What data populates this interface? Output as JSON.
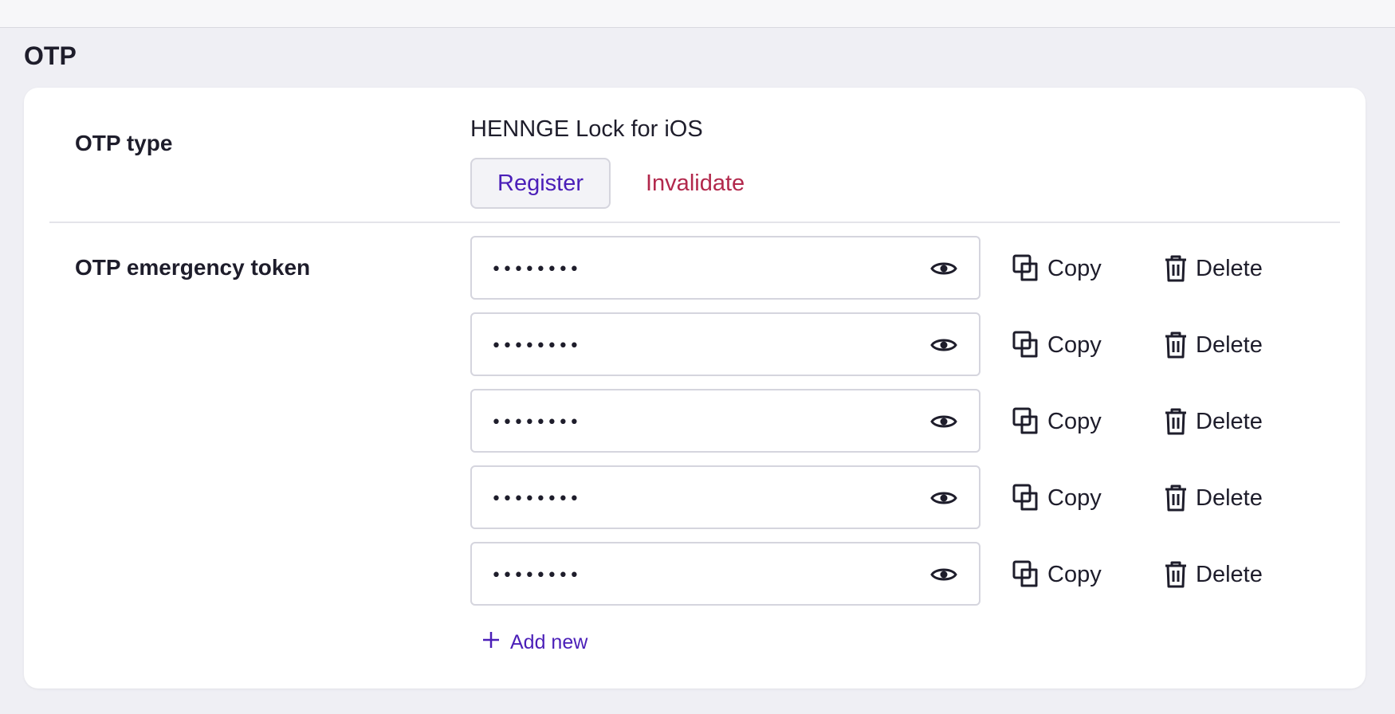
{
  "section": {
    "title": "OTP"
  },
  "otp_type": {
    "label": "OTP type",
    "value": "HENNGE Lock for iOS",
    "register_label": "Register",
    "invalidate_label": "Invalidate"
  },
  "emergency_tokens": {
    "label": "OTP emergency token",
    "tokens": [
      {
        "masked_value": "••••••••",
        "copy_label": "Copy",
        "delete_label": "Delete"
      },
      {
        "masked_value": "••••••••",
        "copy_label": "Copy",
        "delete_label": "Delete"
      },
      {
        "masked_value": "••••••••",
        "copy_label": "Copy",
        "delete_label": "Delete"
      },
      {
        "masked_value": "••••••••",
        "copy_label": "Copy",
        "delete_label": "Delete"
      },
      {
        "masked_value": "••••••••",
        "copy_label": "Copy",
        "delete_label": "Delete"
      }
    ],
    "add_new_label": "Add new"
  },
  "icons": {
    "reveal": "eye-icon",
    "copy": "copy-icon",
    "delete": "trash-icon",
    "add": "plus-icon"
  },
  "colors": {
    "primary": "#4b1fb8",
    "danger": "#b2284c",
    "text": "#1e1d2b",
    "page_bg": "#efeff4"
  }
}
